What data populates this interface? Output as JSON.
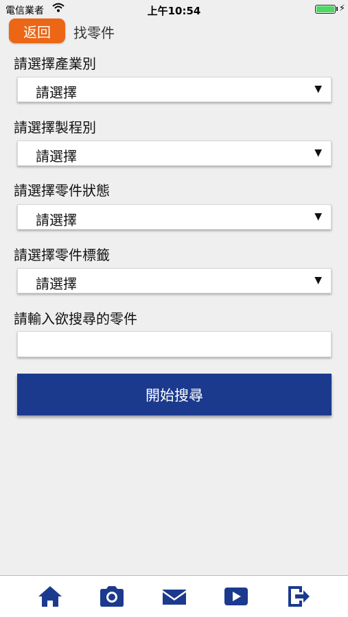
{
  "status_bar": {
    "carrier": "電信業者",
    "time": "上午10:54",
    "battery_level": 1.0
  },
  "nav": {
    "back_label": "返回",
    "title": "找零件"
  },
  "form": {
    "fields": [
      {
        "label": "請選擇產業別",
        "value": "請選擇"
      },
      {
        "label": "請選擇製程別",
        "value": "請選擇"
      },
      {
        "label": "請選擇零件狀態",
        "value": "請選擇"
      },
      {
        "label": "請選擇零件標籤",
        "value": "請選擇"
      }
    ],
    "keyword_label": "請輸入欲搜尋的零件",
    "keyword_value": "",
    "keyword_placeholder": "",
    "search_label": "開始搜尋"
  },
  "tab_bar": {
    "icon_color": "#1b3a8e",
    "items": [
      "home-icon",
      "camera-icon",
      "mail-icon",
      "video-icon",
      "logout-icon"
    ]
  },
  "colors": {
    "accent_orange": "#ec6616",
    "primary_blue": "#1b3a8e",
    "background": "#efeff0"
  }
}
